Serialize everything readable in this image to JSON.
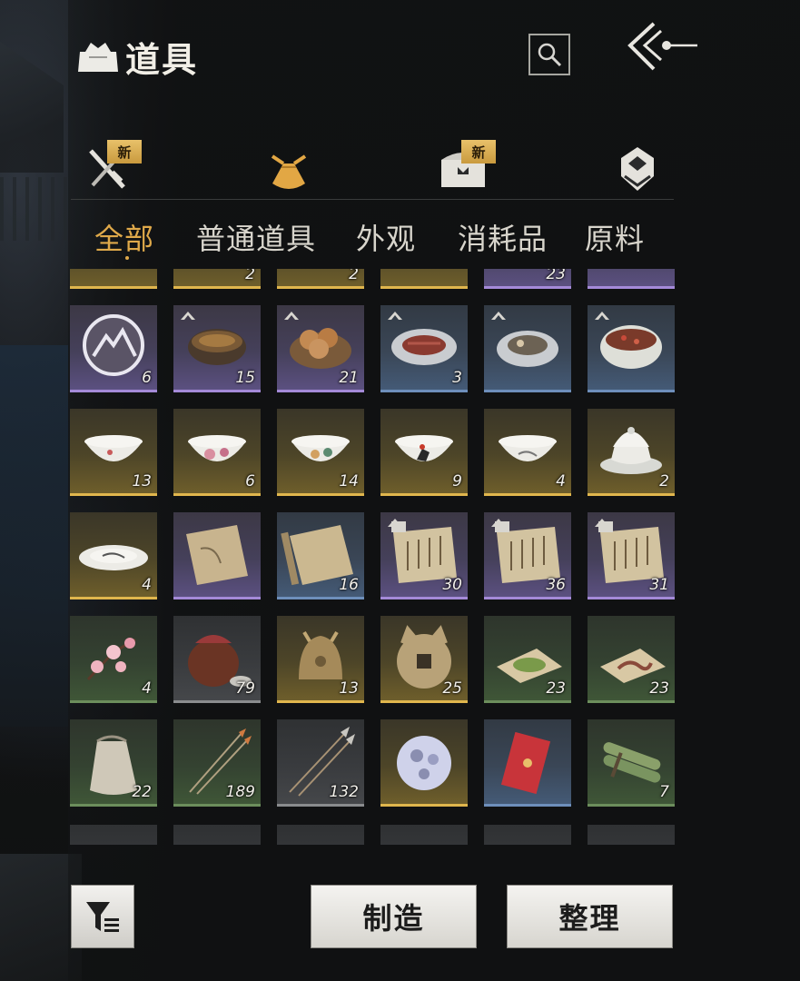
{
  "header": {
    "title": "道具"
  },
  "categories": [
    {
      "icon": "crossed-swords-icon",
      "badge": "新"
    },
    {
      "icon": "pouch-icon",
      "badge": ""
    },
    {
      "icon": "treasure-chest-icon",
      "badge": "新"
    },
    {
      "icon": "badge-emblem-icon",
      "badge": ""
    }
  ],
  "tabs": [
    {
      "label": "全部",
      "active": true
    },
    {
      "label": "普通道具",
      "active": false
    },
    {
      "label": "外观",
      "active": false
    },
    {
      "label": "消耗品",
      "active": false
    },
    {
      "label": "原料",
      "active": false
    }
  ],
  "rows": [
    [
      {
        "count": "",
        "rarity": "gold"
      },
      {
        "count": "2",
        "rarity": "gold"
      },
      {
        "count": "2",
        "rarity": "gold"
      },
      {
        "count": "",
        "rarity": "gold"
      },
      {
        "count": "23",
        "rarity": "purple"
      },
      {
        "count": "",
        "rarity": "purple"
      }
    ],
    [
      {
        "item": "mountain-emblem-icon",
        "count": "6",
        "rarity": "purple"
      },
      {
        "item": "stew-pot-icon",
        "count": "15",
        "rarity": "purple",
        "tier": true
      },
      {
        "item": "buns-basket-icon",
        "count": "21",
        "rarity": "purple",
        "tier": true
      },
      {
        "item": "sliced-meat-plate-icon",
        "count": "3",
        "rarity": "blue",
        "tier": true
      },
      {
        "item": "braised-fish-plate-icon",
        "count": "",
        "rarity": "blue",
        "tier": true
      },
      {
        "item": "pepper-dish-bowl-icon",
        "count": "",
        "rarity": "blue",
        "tier": true
      }
    ],
    [
      {
        "item": "porcelain-bowl-icon",
        "count": "13",
        "rarity": "gold"
      },
      {
        "item": "peony-bowl-icon",
        "count": "6",
        "rarity": "gold"
      },
      {
        "item": "floral-bowl-icon",
        "count": "14",
        "rarity": "gold"
      },
      {
        "item": "rooster-bowl-icon",
        "count": "9",
        "rarity": "gold"
      },
      {
        "item": "ink-bowl-icon",
        "count": "4",
        "rarity": "gold"
      },
      {
        "item": "covered-tea-bowl-icon",
        "count": "2",
        "rarity": "gold"
      }
    ],
    [
      {
        "item": "shallow-dish-icon",
        "count": "4",
        "rarity": "gold"
      },
      {
        "item": "scroll-map-icon",
        "count": "",
        "rarity": "purple"
      },
      {
        "item": "scroll-icon",
        "count": "16",
        "rarity": "blue"
      },
      {
        "item": "manual-page-icon",
        "count": "30",
        "rarity": "purple",
        "tier": true
      },
      {
        "item": "manual-page-icon",
        "count": "36",
        "rarity": "purple",
        "tier": true
      },
      {
        "item": "manual-page-icon",
        "count": "31",
        "rarity": "purple",
        "tier": true
      }
    ],
    [
      {
        "item": "plum-blossom-icon",
        "count": "4",
        "rarity": "green"
      },
      {
        "item": "wine-jar-icon",
        "count": "79",
        "rarity": "gray"
      },
      {
        "item": "bronze-bell-icon",
        "count": "13",
        "rarity": "gold"
      },
      {
        "item": "coin-charm-icon",
        "count": "25",
        "rarity": "gold"
      },
      {
        "item": "green-powder-icon",
        "count": "23",
        "rarity": "green"
      },
      {
        "item": "worm-on-cloth-icon",
        "count": "23",
        "rarity": "green"
      }
    ],
    [
      {
        "item": "cloth-sack-icon",
        "count": "22",
        "rarity": "green"
      },
      {
        "item": "arrows-icon",
        "count": "189",
        "rarity": "green"
      },
      {
        "item": "spear-arrows-icon",
        "count": "132",
        "rarity": "gray"
      },
      {
        "item": "pearl-orb-icon",
        "count": "",
        "rarity": "gold"
      },
      {
        "item": "red-envelope-icon",
        "count": "",
        "rarity": "blue"
      },
      {
        "item": "bamboo-bundle-icon",
        "count": "7",
        "rarity": "green"
      }
    ],
    [
      {
        "count": "",
        "rarity": "gray"
      },
      {
        "count": "",
        "rarity": "gray"
      },
      {
        "count": "",
        "rarity": "gray"
      },
      {
        "count": "",
        "rarity": "gray"
      },
      {
        "count": "",
        "rarity": "gray"
      },
      {
        "count": "",
        "rarity": "gray"
      }
    ]
  ],
  "footer": {
    "craft_label": "制造",
    "sort_label": "整理"
  }
}
